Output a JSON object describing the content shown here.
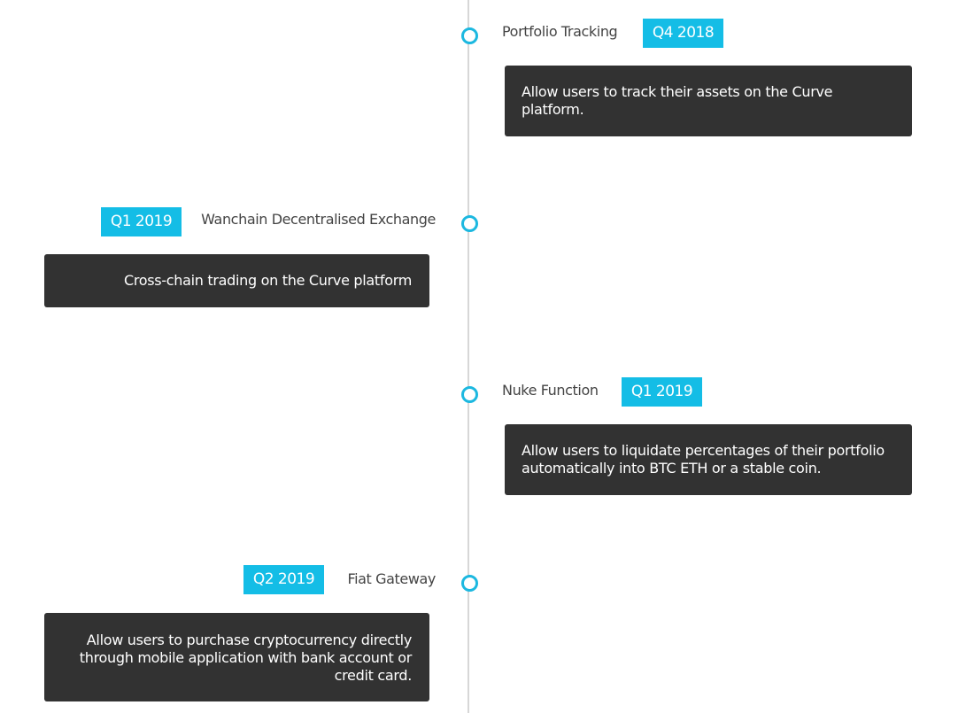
{
  "colors": {
    "accent": "#14bde6",
    "node_ring": "#1cb8e0",
    "card_bg": "#323232",
    "line": "#d7d7d7",
    "title_text": "#444444"
  },
  "timeline": {
    "items": [
      {
        "side": "right",
        "title": "Portfolio Tracking",
        "date": "Q4 2018",
        "description": "Allow users to track their assets on the Curve platform."
      },
      {
        "side": "left",
        "title": "Wanchain Decentralised Exchange",
        "date": "Q1 2019",
        "description": "Cross-chain trading on the Curve platform"
      },
      {
        "side": "right",
        "title": "Nuke Function",
        "date": "Q1 2019",
        "description": "Allow users to liquidate percentages of their portfolio automatically into BTC ETH or a stable coin."
      },
      {
        "side": "left",
        "title": "Fiat Gateway",
        "date": "Q2 2019",
        "description": "Allow users to purchase cryptocurrency directly through mobile application with bank account or credit card."
      }
    ]
  }
}
